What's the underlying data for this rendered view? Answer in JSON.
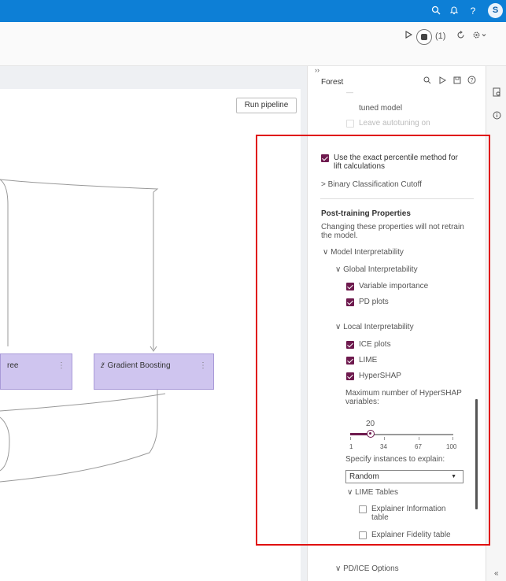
{
  "topbar": {
    "avatar_letter": "S",
    "search_icon": "search-icon",
    "bell_icon": "bell-icon",
    "help_icon": "help-icon",
    "help_glyph": "?"
  },
  "toolbar": {
    "run_icon": "play-icon",
    "people_count": "(1)",
    "refresh_icon": "refresh-icon",
    "gear_icon": "gear-icon"
  },
  "canvas": {
    "run_pipeline": "Run pipeline",
    "nodes": [
      {
        "label": "ree",
        "menu": "⋮"
      },
      {
        "label": "Gradient Boosting",
        "menu": "⋮"
      }
    ]
  },
  "panel": {
    "collapse_label": "››",
    "title": "Forest",
    "tuned_model": "tuned model",
    "leave_autotuning": "Leave autotuning on",
    "exact_percentile": "Use the exact percentile method for lift calculations",
    "binary_cutoff": "> Binary Classification Cutoff",
    "post_training_title": "Post-training Properties",
    "post_training_desc": "Changing these properties will not retrain the model.",
    "model_interp": "∨  Model Interpretability",
    "global_interp": "∨  Global Interpretability",
    "variable_importance": "Variable importance",
    "pd_plots": "PD plots",
    "local_interp": "∨  Local Interpretability",
    "ice_plots": "ICE plots",
    "lime": "LIME",
    "hypershap": "HyperSHAP",
    "max_hypershap": "Maximum number of HyperSHAP variables:",
    "slider": {
      "value": "20",
      "ticks": [
        "1",
        "34",
        "67",
        "100"
      ]
    },
    "specify_instances": "Specify instances to explain:",
    "instances_value": "Random",
    "lime_tables": "∨  LIME Tables",
    "explainer_info": "Explainer Information table",
    "explainer_fidelity": "Explainer Fidelity table",
    "pdice_options": "∨  PD/ICE Options"
  },
  "rail": {
    "expand_label": "«"
  },
  "colors": {
    "accent": "#6e1a4e",
    "topbar": "#0d7fd6",
    "node": "#cfc5ef",
    "highlight": "#e01010"
  }
}
